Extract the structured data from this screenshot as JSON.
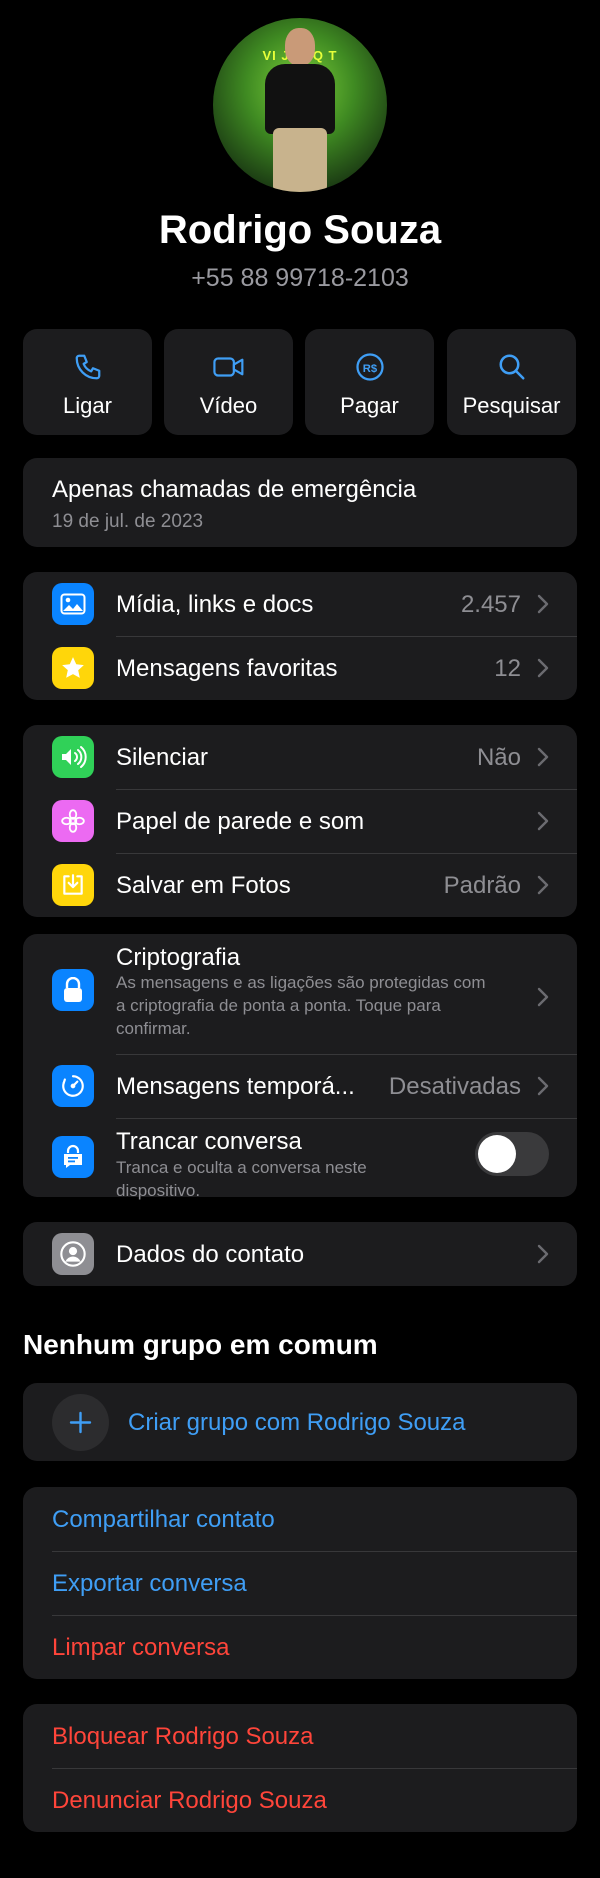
{
  "profile": {
    "name": "Rodrigo Souza",
    "phone": "+55 88 99718-2103",
    "photo_sign": "VI J FAQ T"
  },
  "actions": [
    {
      "label": "Ligar",
      "icon": "phone-icon"
    },
    {
      "label": "Vídeo",
      "icon": "video-icon"
    },
    {
      "label": "Pagar",
      "icon": "pay-icon"
    },
    {
      "label": "Pesquisar",
      "icon": "search-icon"
    }
  ],
  "status": {
    "text": "Apenas chamadas de emergência",
    "date": "19 de jul. de 2023"
  },
  "media": [
    {
      "label": "Mídia, links e docs",
      "value": "2.457",
      "icon": "photo-icon",
      "color": "#0a84ff"
    },
    {
      "label": "Mensagens favoritas",
      "value": "12",
      "icon": "star-icon",
      "color": "#ffd60a"
    }
  ],
  "settings": [
    {
      "label": "Silenciar",
      "value": "Não",
      "icon": "speaker-icon",
      "color": "#30d158"
    },
    {
      "label": "Papel de parede e som",
      "value": "",
      "icon": "flower-icon",
      "color": "#ec6af2"
    },
    {
      "label": "Salvar em Fotos",
      "value": "Padrão",
      "icon": "download-icon",
      "color": "#ffd60a"
    }
  ],
  "privacy": {
    "encryption": {
      "title": "Criptografia",
      "desc1": "As mensagens e as ligações são protegidas com",
      "desc2": "a criptografia de ponta a ponta. Toque para",
      "desc3": "confirmar."
    },
    "disappearing": {
      "title": "Mensagens temporá...",
      "value": "Desativadas"
    },
    "lock": {
      "title": "Trancar conversa",
      "desc1": "Tranca e oculta a conversa neste",
      "desc2": "dispositivo.",
      "enabled": false
    }
  },
  "contact_details": {
    "label": "Dados do contato"
  },
  "groups": {
    "heading": "Nenhum grupo em comum",
    "create": "Criar grupo com Rodrigo Souza"
  },
  "options": [
    {
      "label": "Compartilhar contato",
      "color": "#3f9ef5"
    },
    {
      "label": "Exportar conversa",
      "color": "#3f9ef5"
    },
    {
      "label": "Limpar conversa",
      "color": "#ff453a"
    }
  ],
  "danger": [
    {
      "label": "Bloquear Rodrigo Souza"
    },
    {
      "label": "Denunciar Rodrigo Souza"
    }
  ]
}
